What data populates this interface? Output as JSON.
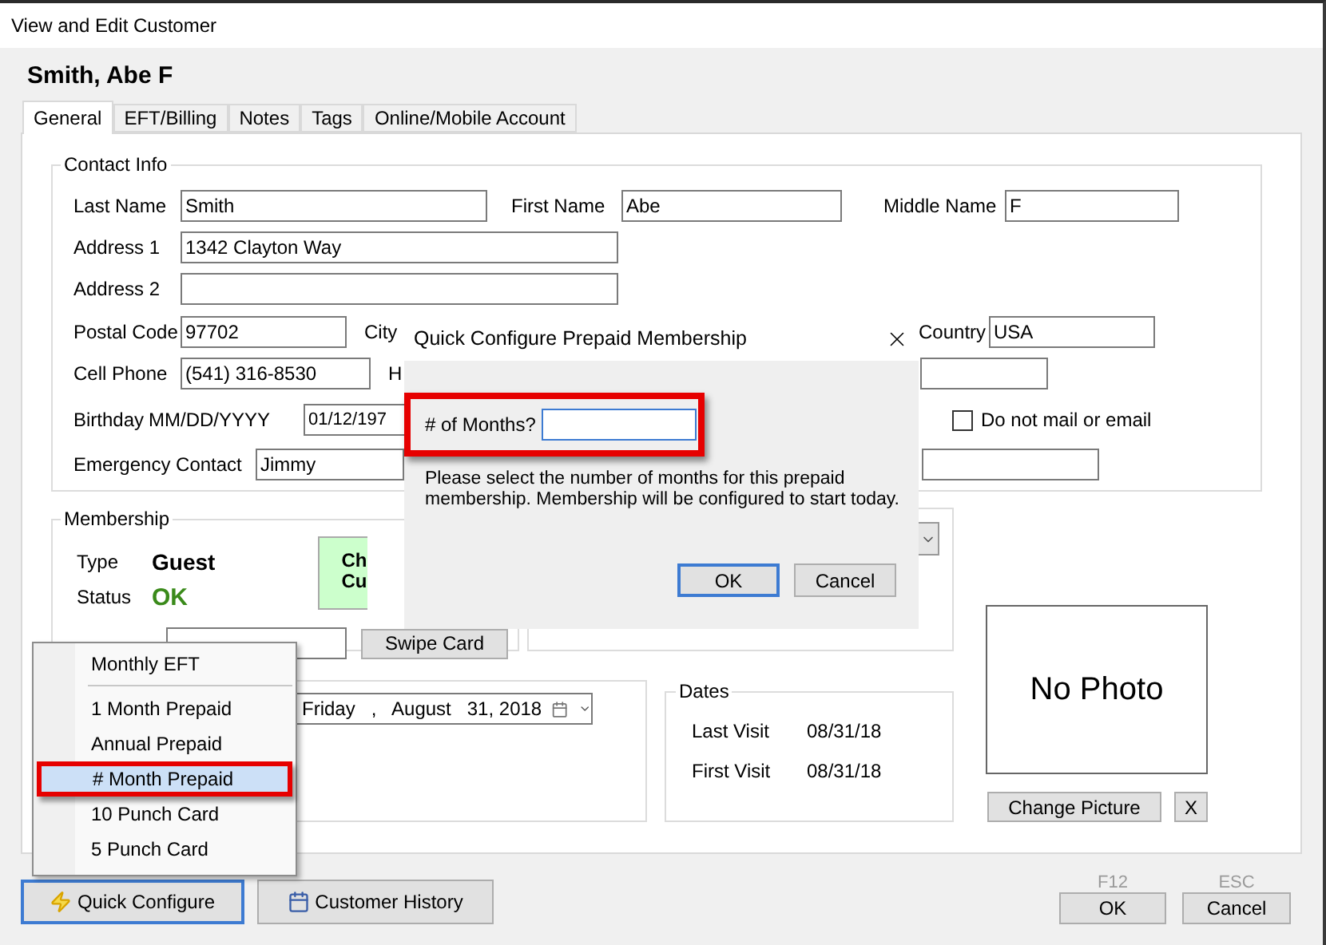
{
  "window": {
    "title": "View and Edit Customer"
  },
  "customer_name": "Smith, Abe F",
  "tabs": [
    {
      "label": "General",
      "selected": true
    },
    {
      "label": "EFT/Billing",
      "selected": false
    },
    {
      "label": "Notes",
      "selected": false
    },
    {
      "label": "Tags",
      "selected": false
    },
    {
      "label": "Online/Mobile Account",
      "selected": false
    }
  ],
  "contact_info": {
    "title": "Contact Info",
    "last_name": {
      "label": "Last Name",
      "value": "Smith"
    },
    "first_name": {
      "label": "First Name",
      "value": "Abe"
    },
    "middle_name": {
      "label": "Middle Name",
      "value": "F"
    },
    "address_1": {
      "label": "Address 1",
      "value": "1342 Clayton Way"
    },
    "address_2": {
      "label": "Address 2"
    },
    "postal_code": {
      "label": "Postal Code",
      "value": "97702"
    },
    "city": {
      "label": "City"
    },
    "country": {
      "label": "Country",
      "value": "USA"
    },
    "cell_phone": {
      "label": "Cell Phone",
      "value": "(541) 316-8530"
    },
    "home_phone": {
      "label": "H"
    },
    "birthday": {
      "label": "Birthday",
      "format": "MM/DD/YYYY",
      "value": "01/12/197"
    },
    "do_not_mail": {
      "label": "Do not mail or email",
      "checked": false
    },
    "emergency_contact": {
      "label": "Emergency Contact",
      "value": "Jimmy"
    }
  },
  "membership": {
    "title": "Membership",
    "type_label": "Type",
    "type": "Guest",
    "status_label": "Status",
    "status": "OK",
    "check_in_lines": [
      "Ch",
      "Cu"
    ],
    "swipe_button": "Swipe Card"
  },
  "date_picker": {
    "value": "Friday   ,   August   31, 2018"
  },
  "dates": {
    "title": "Dates",
    "rows": [
      {
        "label": "Last Visit",
        "value": "08/31/18"
      },
      {
        "label": "First Visit",
        "value": "08/31/18"
      }
    ]
  },
  "photo": {
    "text": "No Photo",
    "change_button": "Change Picture",
    "clear_button": "X"
  },
  "footer": {
    "quick_configure": {
      "label": "Quick Configure",
      "focused": true
    },
    "history": {
      "label": "Customer History",
      "focused": false
    },
    "ok": {
      "hotkey": "F12",
      "label": "OK"
    },
    "cancel": {
      "hotkey": "ESC",
      "label": "Cancel"
    }
  },
  "dialog": {
    "title": "Quick Configure Prepaid Membership",
    "months_label": "# of Months?",
    "callout": true,
    "message": "Please select the number of months for this prepaid membership.  Membership will be configured to start today.",
    "buttons": [
      {
        "label": "OK",
        "default": true
      },
      {
        "label": "Cancel",
        "default": false
      }
    ]
  },
  "menu": {
    "items": [
      {
        "label": "Monthly EFT",
        "selected": false,
        "separator_after": true,
        "callout": false
      },
      {
        "label": "1 Month Prepaid",
        "selected": false,
        "separator_after": false,
        "callout": false
      },
      {
        "label": "Annual Prepaid",
        "selected": false,
        "separator_after": false,
        "callout": false
      },
      {
        "label": "# Month Prepaid",
        "selected": true,
        "separator_after": false,
        "callout": true
      },
      {
        "label": "10 Punch Card",
        "selected": false,
        "separator_after": false,
        "callout": false
      },
      {
        "label": "5 Punch Card",
        "selected": false,
        "separator_after": false,
        "callout": false
      }
    ]
  }
}
